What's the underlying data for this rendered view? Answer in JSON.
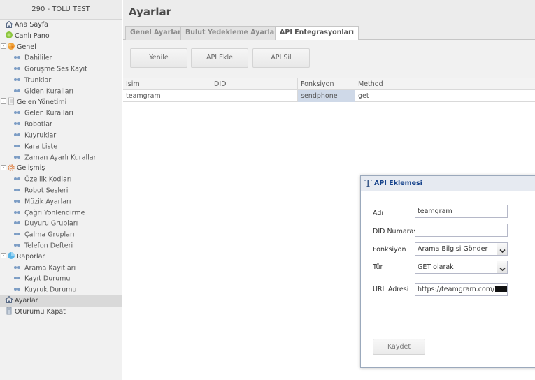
{
  "sidebar": {
    "title": "290 - TOLU TEST",
    "items": [
      {
        "label": "Ana Sayfa",
        "level": 0,
        "icon": "home-icon"
      },
      {
        "label": "Canlı Pano",
        "level": 0,
        "icon": "live-board-icon"
      },
      {
        "label": "Genel",
        "level": 0,
        "icon": "folder-general-icon",
        "toggle": "-"
      },
      {
        "label": "Dahililer",
        "level": 1
      },
      {
        "label": "Görüşme Ses Kayıt",
        "level": 1
      },
      {
        "label": "Trunklar",
        "level": 1
      },
      {
        "label": "Giden Kuralları",
        "level": 1
      },
      {
        "label": "Gelen Yönetimi",
        "level": 0,
        "icon": "document-icon",
        "toggle": "-"
      },
      {
        "label": "Gelen Kuralları",
        "level": 1
      },
      {
        "label": "Robotlar",
        "level": 1
      },
      {
        "label": "Kuyruklar",
        "level": 1
      },
      {
        "label": "Kara Liste",
        "level": 1
      },
      {
        "label": "Zaman Ayarlı Kurallar",
        "level": 1
      },
      {
        "label": "Gelişmiş",
        "level": 0,
        "icon": "gear-icon",
        "toggle": "-"
      },
      {
        "label": "Özellik Kodları",
        "level": 1
      },
      {
        "label": "Robot Sesleri",
        "level": 1
      },
      {
        "label": "Müzik Ayarları",
        "level": 1
      },
      {
        "label": "Çağrı Yönlendirme",
        "level": 1
      },
      {
        "label": "Duyuru Grupları",
        "level": 1
      },
      {
        "label": "Çalma Grupları",
        "level": 1
      },
      {
        "label": "Telefon Defteri",
        "level": 1
      },
      {
        "label": "Raporlar",
        "level": 0,
        "icon": "reports-icon",
        "toggle": "-"
      },
      {
        "label": "Arama Kayıtları",
        "level": 1
      },
      {
        "label": "Kayıt Durumu",
        "level": 1
      },
      {
        "label": "Kuyruk Durumu",
        "level": 1
      },
      {
        "label": "Ayarlar",
        "level": 0,
        "icon": "settings-home-icon",
        "selected": true
      },
      {
        "label": "Oturumu Kapat",
        "level": 0,
        "icon": "logout-icon"
      }
    ]
  },
  "main": {
    "title": "Ayarlar",
    "tabs": [
      {
        "label": "Genel Ayarlar",
        "active": false
      },
      {
        "label": "Bulut Yedekleme Ayarları",
        "active": false
      },
      {
        "label": "API Entegrasyonları",
        "active": true
      }
    ],
    "toolbar": {
      "refresh_label": "Yenile",
      "add_api_label": "API Ekle",
      "delete_api_label": "API Sil"
    },
    "grid": {
      "columns": [
        "İsim",
        "DID",
        "Fonksiyon",
        "Method"
      ],
      "rows": [
        [
          "teamgram",
          "",
          "sendphone",
          "get"
        ]
      ]
    }
  },
  "dialog": {
    "title": "API Eklemesi",
    "fields": {
      "name_label": "Adı",
      "name_value": "teamgram",
      "did_label": "DID Numarası",
      "did_value": "",
      "function_label": "Fonksiyon",
      "function_value": "Arama Bilgisi Gönder",
      "type_label": "Tür",
      "type_value": "GET olarak",
      "url_label": "URL Adresi",
      "url_value": "https://teamgram.com/"
    },
    "save_label": "Kaydet"
  },
  "colors": {
    "sidebar_bg": "#f1f1f1",
    "selected_row": "#cfd9e8",
    "dialog_title": "#15428b"
  }
}
